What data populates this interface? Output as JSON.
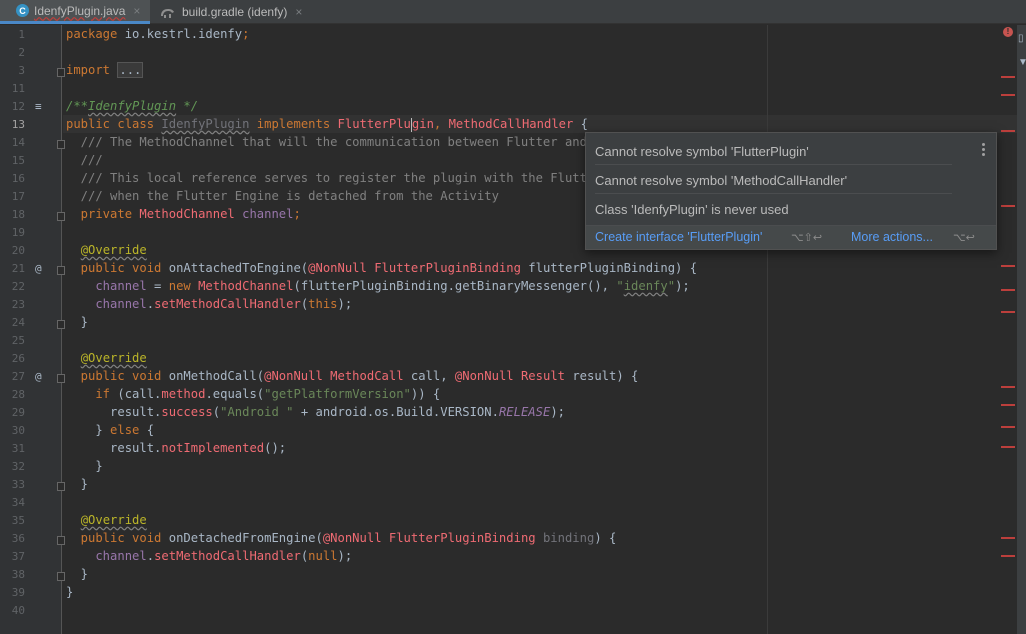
{
  "tabs": [
    {
      "label": "IdenfyPlugin.java",
      "icon": "java-class-icon",
      "active": true
    },
    {
      "label": "build.gradle (idenfy)",
      "icon": "gradle-icon",
      "active": false
    }
  ],
  "close_glyph": "×",
  "line_numbers": [
    "1",
    "2",
    "3",
    "11",
    "12",
    "13",
    "14",
    "15",
    "16",
    "17",
    "18",
    "19",
    "20",
    "21",
    "22",
    "23",
    "24",
    "25",
    "26",
    "27",
    "28",
    "29",
    "30",
    "31",
    "32",
    "33",
    "34",
    "35",
    "36",
    "37",
    "38",
    "39",
    "40"
  ],
  "code": {
    "l1_kw": "package",
    "l1_pkg": " io.kestrl.idenfy",
    "l1_semi": ";",
    "l3_kw": "import ",
    "l3_fold": "...",
    "l12_open": "/**",
    "l12_name": "IdenfyPlugin",
    "l12_close": " */",
    "l13_kw1": "public class ",
    "l13_cls": "IdenfyPlugin",
    "l13_kw2": " implements ",
    "l13_t1a": "FlutterPlu",
    "l13_t1b": "gin",
    "l13_comma": ", ",
    "l13_t2": "MethodCallHandler",
    "l13_brace": " {",
    "l14": "  /// The MethodChannel that will the communication between Flutter and na",
    "l15": "  ///",
    "l16": "  /// This local reference serves to register the plugin with the Flutter",
    "l17": "  /// when the Flutter Engine is detached from the Activity",
    "l18_kw": "  private ",
    "l18_type": "MethodChannel",
    "l18_field": " channel",
    "l18_semi": ";",
    "override": "@Override",
    "l21_kw": "  public void ",
    "l21_name": "onAttachedToEngine(",
    "l21_ann": "@NonNull ",
    "l21_type": "FlutterPluginBinding",
    "l21_rest": " flutterPluginBinding) {",
    "l22_field": "    channel",
    "l22_eq": " = ",
    "l22_new": "new ",
    "l22_type": "MethodChannel",
    "l22_mid": "(flutterPluginBinding.",
    "l22_meth": "getBinaryMessenger",
    "l22_mid2": "(), ",
    "l22_str1": "\"",
    "l22_str2": "idenfy",
    "l22_str3": "\"",
    "l22_end": ");",
    "l23_field": "    channel",
    "l23_dot": ".",
    "l23_meth": "setMethodCallHandler",
    "l23_open": "(",
    "l23_this": "this",
    "l23_end": ");",
    "close2": "  }",
    "l27_kw": "  public void ",
    "l27_name": "onMethodCall(",
    "l27_ann1": "@NonNull ",
    "l27_type1": "MethodCall",
    "l27_mid": " call, ",
    "l27_ann2": "@NonNull ",
    "l27_type2": "Result",
    "l27_rest": " result) {",
    "l28_kw": "    if ",
    "l28_a": "(call.",
    "l28_field": "method",
    "l28_b": ".equals(",
    "l28_str": "\"getPlatformVersion\"",
    "l28_c": ")) {",
    "l29_a": "      result.",
    "l29_meth": "success",
    "l29_b": "(",
    "l29_str": "\"Android \"",
    "l29_c": " + android.os.Build.VERSION.",
    "l29_const": "RELEASE",
    "l29_d": ");",
    "l30_a": "    } ",
    "l30_kw": "else",
    "l30_b": " {",
    "l31_a": "      result.",
    "l31_meth": "notImplemented",
    "l31_b": "();",
    "close4": "    }",
    "l36_kw": "  public void ",
    "l36_name": "onDetachedFromEngine(",
    "l36_ann": "@NonNull ",
    "l36_type": "FlutterPluginBinding",
    "l36_var": " binding",
    "l36_end": ") {",
    "l37_field": "    channel",
    "l37_dot": ".",
    "l37_meth": "setMethodCallHandler",
    "l37_open": "(",
    "l37_null": "null",
    "l37_end": ");",
    "close0": "}"
  },
  "gutter_marks": {
    "override": "@",
    "structure": "≡"
  },
  "popup": {
    "messages": [
      "Cannot resolve symbol 'FlutterPlugin'",
      "Cannot resolve symbol 'MethodCallHandler'",
      "Class 'IdenfyPlugin' is never used"
    ],
    "action_primary": "Create interface 'FlutterPlugin'",
    "action_primary_shortcut": "⌥⇧↩",
    "action_more": "More actions...",
    "action_more_shortcut": "⌥↩"
  },
  "error_badge": "!",
  "colors": {
    "error": "#bc3f3c",
    "link": "#589df6",
    "keyword": "#cc7832",
    "string": "#6a8759"
  }
}
